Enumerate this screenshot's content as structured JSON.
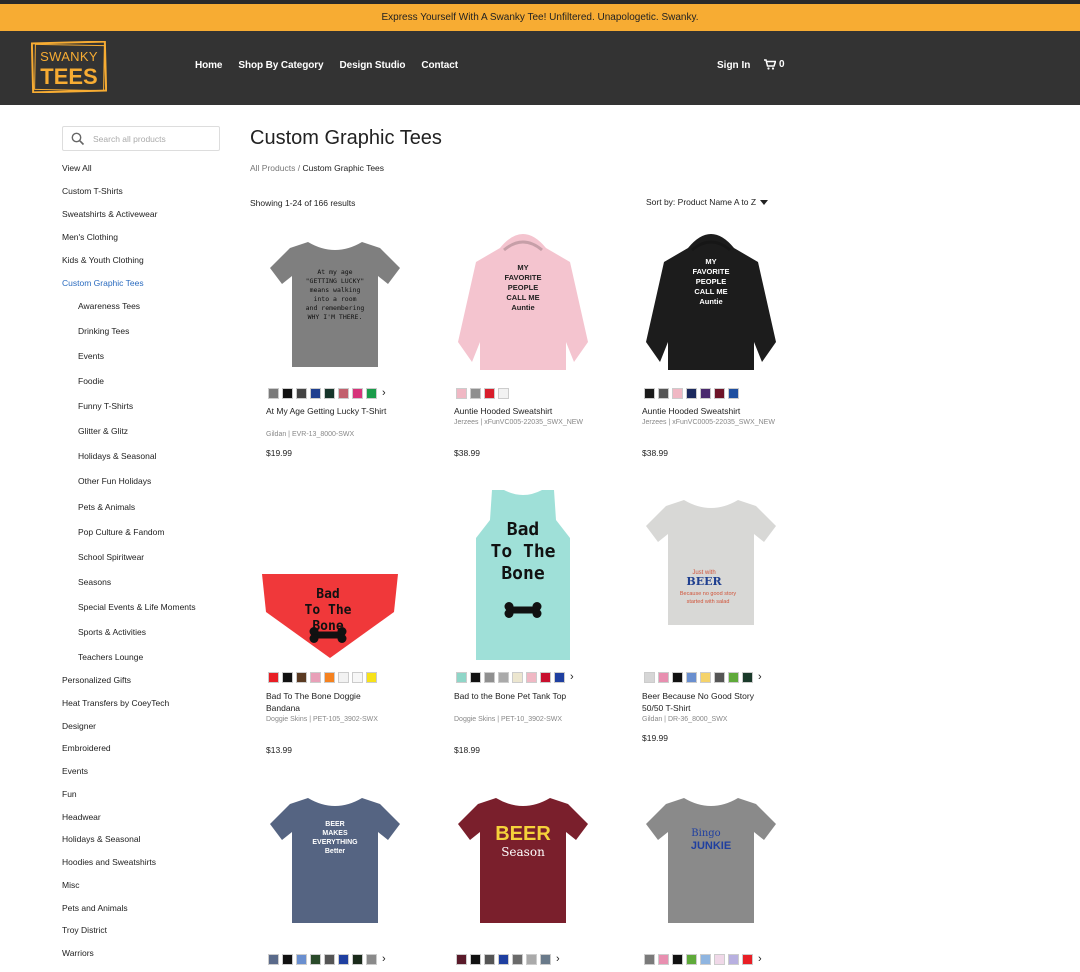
{
  "announcement": "Express Yourself With A Swanky Tee! Unfiltered. Unapologetic. Swanky.",
  "logo": {
    "line1": "SWANKY",
    "line2": "TEES",
    "color": "#f7ac33"
  },
  "nav": [
    "Home",
    "Shop By Category",
    "Design Studio",
    "Contact"
  ],
  "header_right": {
    "signin": "Sign In",
    "cart_count": "0"
  },
  "search": {
    "placeholder": "Search all products"
  },
  "sidebar": {
    "categories": [
      "View All",
      "Custom T-Shirts",
      "Sweatshirts & Activewear",
      "Men's Clothing",
      "Kids & Youth Clothing",
      "Custom Graphic Tees"
    ],
    "subcategories": [
      "Awareness Tees",
      "Drinking Tees",
      "Events",
      "Foodie",
      "Funny T-Shirts",
      "Glitter & Glitz",
      "Holidays & Seasonal",
      "Other Fun Holidays",
      "Pets & Animals",
      "Pop Culture & Fandom",
      "School Spiritwear",
      "Seasons",
      "Special Events & Life Moments",
      "Sports & Activities",
      "Teachers Lounge"
    ],
    "more_categories": [
      "Personalized Gifts",
      "Heat Transfers by CoeyTech",
      "Designer",
      "Embroidered",
      "Events",
      "Fun",
      "Headwear",
      "Holidays & Seasonal",
      "Hoodies and Sweatshirts",
      "Misc",
      "Pets and Animals",
      "Troy District",
      "Warriors"
    ]
  },
  "main": {
    "title": "Custom Graphic Tees",
    "breadcrumb_root": "All Products",
    "breadcrumb_sep": " / ",
    "breadcrumb_current": "Custom Graphic Tees",
    "results": "Showing 1-24 of 166 results",
    "sort": "Sort by: Product Name A to Z"
  },
  "products": [
    {
      "name": "At My Age Getting Lucky T-Shirt",
      "meta": "Gildan | EVR-13_8000-SWX",
      "price": "$19.99",
      "image_text": [
        "At my age",
        "\"GETTING LUCKY\"",
        "means walking",
        "into a room",
        "and remembering",
        "WHY I'M THERE."
      ],
      "swatches": [
        "#7a7a7a",
        "#111111",
        "#444444",
        "#1f3f8f",
        "#16352a",
        "#c2616e",
        "#d6337a",
        "#1a9b4a"
      ],
      "more": true
    },
    {
      "name": "Auntie Hooded Sweatshirt",
      "meta": "Jerzees | xFunVC005-22035_SWX_NEW",
      "price": "$38.99",
      "image_text": [
        "MY",
        "FAVORITE",
        "PEOPLE",
        "CALL ME",
        "Auntie"
      ],
      "swatches": [
        "#f0b8c4",
        "#8f8f8f",
        "#d81e2c",
        "#f2f2f2"
      ],
      "more": false
    },
    {
      "name": "Auntie Hooded Sweatshirt",
      "meta": "Jerzees | xFunVC0005-22035_SWX_NEW",
      "price": "$38.99",
      "image_text": [
        "MY",
        "FAVORITE",
        "PEOPLE",
        "CALL ME",
        "Auntie"
      ],
      "swatches": [
        "#1a1a1a",
        "#555555",
        "#f0b8c4",
        "#1c2a5e",
        "#4a2a6e",
        "#6e1428",
        "#1f4fa0"
      ],
      "more": false
    },
    {
      "name": "Bad To The Bone Doggie Bandana",
      "meta": "Doggie Skins | PET-105_3902-SWX",
      "price": "$13.99",
      "image_text": [
        "Bad",
        "To The",
        "Bone"
      ],
      "swatches": [
        "#e81e25",
        "#111111",
        "#5a3a22",
        "#e8a0b8",
        "#f58220",
        "#f2f2f2",
        "#f7f7f7",
        "#f7e21a"
      ],
      "more": false
    },
    {
      "name": "Bad to the Bone Pet Tank Top",
      "meta": "Doggie Skins | PET-10_3902-SWX",
      "price": "$18.99",
      "image_text": [
        "Bad",
        "To The",
        "Bone"
      ],
      "swatches": [
        "#8fd6c8",
        "#111111",
        "#8f8f8f",
        "#aaaaaa",
        "#ece6cf",
        "#f0b8c4",
        "#c8102e",
        "#1f3fa0"
      ],
      "more": true
    },
    {
      "name": "Beer Because No Good Story 50/50 T-Shirt",
      "meta": "Gildan | DR-36_8000_SWX",
      "price": "$19.99",
      "image_text": [
        "Just with",
        "BEER",
        "Because no good story",
        "started with salad"
      ],
      "swatches": [
        "#d6d6d6",
        "#e88fb0",
        "#111111",
        "#6a8fcf",
        "#f5d36a",
        "#555555",
        "#5faa3a",
        "#1a3a2a"
      ],
      "more": true
    },
    {
      "name": "",
      "meta": "",
      "price": "",
      "image_text": [
        "BEER",
        "MAKES",
        "EVERYTHING",
        "Better"
      ],
      "swatches": [
        "#5a6a8a",
        "#111111",
        "#6a8fcf",
        "#2a4a2a",
        "#555555",
        "#1f3fa0",
        "#1a2a1a",
        "#8a8a8a"
      ],
      "more": true
    },
    {
      "name": "",
      "meta": "",
      "price": "",
      "image_text": [
        "BEER",
        "Season"
      ],
      "swatches": [
        "#5a1a2a",
        "#111111",
        "#555555",
        "#1f3fa0",
        "#6a6a6a",
        "#aaaaaa",
        "#6a7a8a"
      ],
      "more": true
    },
    {
      "name": "",
      "meta": "",
      "price": "",
      "image_text": [
        "Bingo",
        "JUNKIE"
      ],
      "swatches": [
        "#7a7a7a",
        "#e88fb0",
        "#111111",
        "#5faa3a",
        "#8fb5e0",
        "#f0d8e8",
        "#b8b0e0",
        "#e81e25"
      ],
      "more": true
    }
  ]
}
